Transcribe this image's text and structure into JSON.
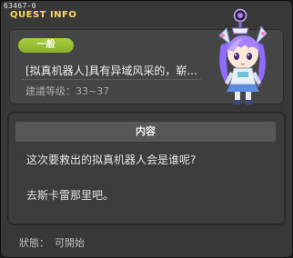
{
  "window": {
    "id": "63467-0",
    "title": "QUEST INFO"
  },
  "quest": {
    "category": "一般",
    "name": "[拟真机器人]具有异域风采的，崭...",
    "level_label": "建議等级：",
    "level_range": "33~37"
  },
  "content": {
    "header": "内容",
    "lines": [
      "这次要救出的拟真机器人会是谁呢?",
      "去斯卡雷那里吧。"
    ]
  },
  "status": {
    "label": "狀態：",
    "value": "可開始"
  },
  "colors": {
    "title": "#ffd95e",
    "badge": "#97c033",
    "window_bg": "#383838"
  }
}
